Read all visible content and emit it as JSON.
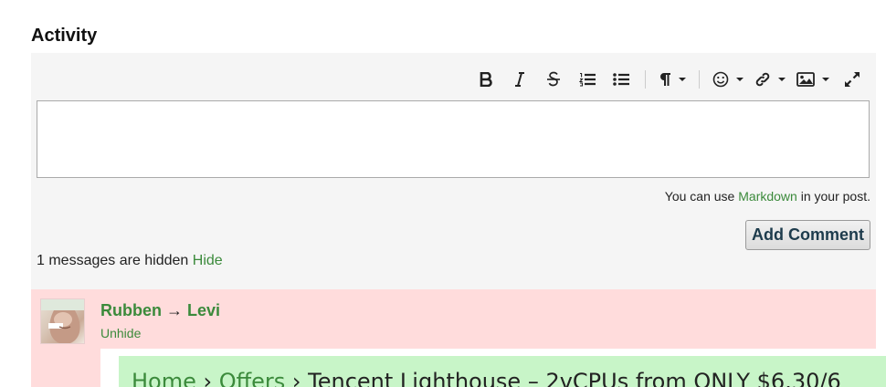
{
  "section": {
    "title": "Activity"
  },
  "toolbar": {
    "buttons": [
      {
        "name": "bold-icon"
      },
      {
        "name": "italic-icon"
      },
      {
        "name": "strikethrough-icon"
      },
      {
        "name": "ordered-list-icon"
      },
      {
        "name": "unordered-list-icon"
      },
      {
        "name": "paragraph-icon"
      },
      {
        "name": "emoji-icon"
      },
      {
        "name": "link-icon"
      },
      {
        "name": "image-icon"
      },
      {
        "name": "fullscreen-icon"
      }
    ]
  },
  "editor": {
    "value": ""
  },
  "markdown_note": {
    "prefix": "You can use ",
    "link": "Markdown",
    "suffix": " in your post."
  },
  "add_comment": {
    "label": "Add Comment"
  },
  "hidden_notice": {
    "text": "1 messages are hidden ",
    "link": "Hide"
  },
  "message": {
    "from": "Rubben",
    "arrow": "→",
    "to": "Levi",
    "unhide_label": "Unhide",
    "quote": {
      "crumb1": "Home",
      "sep1": " › ",
      "crumb2": "Offers",
      "sep2": " › ",
      "title": "Tencent Lighthouse – 2vCPUs from ONLY $6.30/6"
    }
  },
  "colors": {
    "link": "#3b8a3b",
    "panel_bg": "#f5f5f5",
    "hidden_message_bg": "#ffdcdc",
    "quote_bg": "#c8f5c8"
  }
}
